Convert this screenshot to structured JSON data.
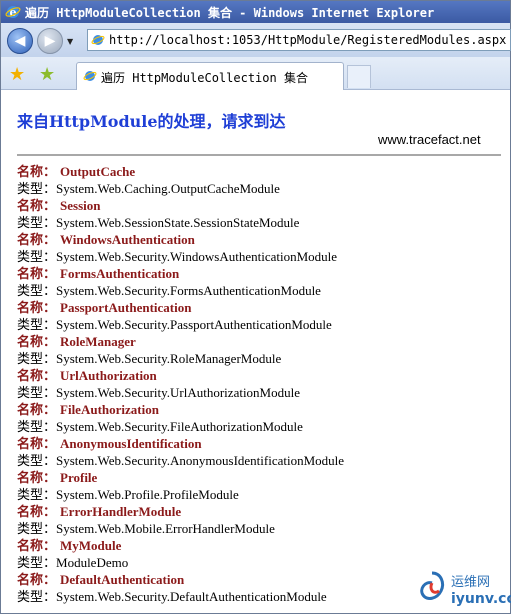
{
  "window": {
    "title": "遍历 HttpModuleCollection 集合 - Windows Internet Explorer"
  },
  "address_bar": {
    "url": "http://localhost:1053/HttpModule/RegisteredModules.aspx"
  },
  "tab": {
    "label": "遍历 HttpModuleCollection 集合"
  },
  "page": {
    "heading": "来自HttpModule的处理，请求到达",
    "site": "www.tracefact.net",
    "name_label": "名称：",
    "type_label": "类型：",
    "modules": [
      {
        "name": "OutputCache",
        "type": "System.Web.Caching.OutputCacheModule"
      },
      {
        "name": "Session",
        "type": "System.Web.SessionState.SessionStateModule"
      },
      {
        "name": "WindowsAuthentication",
        "type": "System.Web.Security.WindowsAuthenticationModule"
      },
      {
        "name": "FormsAuthentication",
        "type": "System.Web.Security.FormsAuthenticationModule"
      },
      {
        "name": "PassportAuthentication",
        "type": "System.Web.Security.PassportAuthenticationModule"
      },
      {
        "name": "RoleManager",
        "type": "System.Web.Security.RoleManagerModule"
      },
      {
        "name": "UrlAuthorization",
        "type": "System.Web.Security.UrlAuthorizationModule"
      },
      {
        "name": "FileAuthorization",
        "type": "System.Web.Security.FileAuthorizationModule"
      },
      {
        "name": "AnonymousIdentification",
        "type": "System.Web.Security.AnonymousIdentificationModule"
      },
      {
        "name": "Profile",
        "type": "System.Web.Profile.ProfileModule"
      },
      {
        "name": "ErrorHandlerModule",
        "type": "System.Web.Mobile.ErrorHandlerModule"
      },
      {
        "name": "MyModule",
        "type": "ModuleDemo"
      },
      {
        "name": "DefaultAuthentication",
        "type": "System.Web.Security.DefaultAuthenticationModule"
      }
    ]
  },
  "watermark": {
    "top": "运维网",
    "bottom": "iyunv.com"
  },
  "colors": {
    "heading": "#1f3fd6",
    "module_name": "#8b1a1a",
    "titlebar": "#3b5aa3"
  },
  "icons": {
    "browser": "ie-icon",
    "favorites": "star-icon",
    "add_favorites": "add-star-icon",
    "back": "back-arrow-icon",
    "forward": "forward-arrow-icon"
  }
}
